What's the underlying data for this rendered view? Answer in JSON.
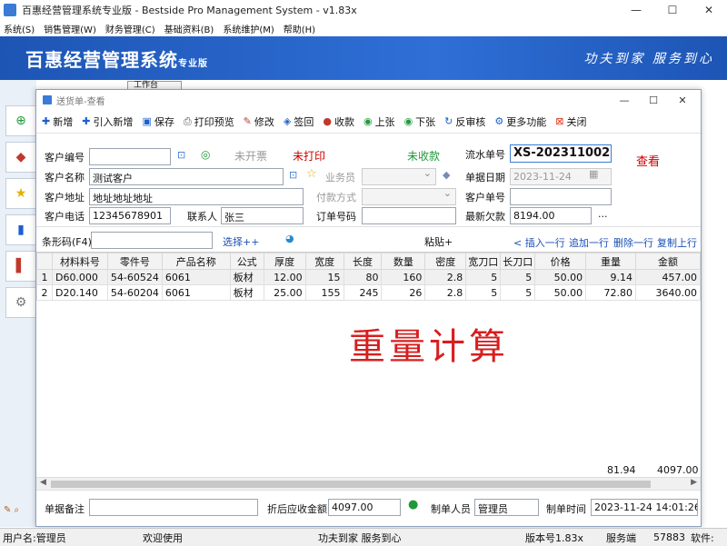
{
  "window": {
    "title": "百惠经营管理系统专业版 - Bestside Pro Management System - v1.83x",
    "minimize": "—",
    "maximize": "☐",
    "close": "✕"
  },
  "menu": [
    "系统(S)",
    "销售管理(W)",
    "财务管理(C)",
    "基础资料(B)",
    "系统维护(M)",
    "帮助(H)"
  ],
  "banner": {
    "brand": "百惠经营管理系统",
    "edition": "专业版",
    "slogan": "功夫到家 服务到心"
  },
  "sidebar": {
    "tab_label": "工作台"
  },
  "child_window": {
    "title": "送货单-查看",
    "minimize": "—",
    "maximize": "☐",
    "close": "✕"
  },
  "toolbar": {
    "items": [
      {
        "label": "新增",
        "icon": "plus-icon",
        "color": "#1a5fcf"
      },
      {
        "label": "引入新增",
        "icon": "plus-icon",
        "color": "#1a5fcf"
      },
      {
        "label": "保存",
        "icon": "save-icon",
        "color": "#1a5fcf"
      },
      {
        "label": "打印预览",
        "icon": "printer-icon",
        "color": "#555555"
      },
      {
        "label": "修改",
        "icon": "edit-icon",
        "color": "#c0392b"
      },
      {
        "label": "签回",
        "icon": "sign-icon",
        "color": "#2a62c9"
      },
      {
        "label": "收款",
        "icon": "money-icon",
        "color": "#c0392b"
      },
      {
        "label": "上张",
        "icon": "up-icon",
        "color": "#1f9a3a"
      },
      {
        "label": "下张",
        "icon": "down-icon",
        "color": "#1f9a3a"
      },
      {
        "label": "反审核",
        "icon": "reverse-icon",
        "color": "#1a5fcf"
      },
      {
        "label": "更多功能",
        "icon": "gear-icon",
        "color": "#1a5fcf"
      },
      {
        "label": "关闭",
        "icon": "close-icon",
        "color": "#d9381e"
      }
    ]
  },
  "form": {
    "customer_no_label": "客户编号",
    "customer_no": "",
    "invoice_status": "未开票",
    "print_status": "未打印",
    "payment_status": "未收款",
    "serial_label": "流水单号",
    "serial_no": "XS-202311002",
    "mode_tag": "查看",
    "customer_name_label": "客户名称",
    "customer_name": "测试客户",
    "salesman_label": "业务员",
    "salesman": "",
    "doc_date_label": "单据日期",
    "doc_date": "2023-11-24",
    "customer_addr_label": "客户地址",
    "customer_addr": "地址地址地址",
    "pay_method_label": "付款方式",
    "pay_method": "",
    "customer_order_label": "客户单号",
    "customer_order": "",
    "customer_phone_label": "客户电话",
    "customer_phone": "12345678901",
    "contact_label": "联系人",
    "contact": "张三",
    "order_no_label": "订单号码",
    "order_no": "",
    "latest_debt_label": "最新欠款",
    "latest_debt": "8194.00",
    "more": "...",
    "barcode_label": "条形码(F4)",
    "barcode": "",
    "select_link": "选择++",
    "paste_label": "粘贴+",
    "insert_row": "插入一行",
    "append_row": "追加一行",
    "delete_row": "删除一行",
    "copy_prev": "复制上行"
  },
  "table": {
    "columns": [
      "",
      "材料料号",
      "零件号",
      "产品名称",
      "公式",
      "厚度",
      "宽度",
      "长度",
      "数量",
      "密度",
      "宽刀口",
      "长刀口",
      "价格",
      "重量",
      "金额"
    ],
    "rows": [
      [
        "1",
        "D60.000",
        "54-60524",
        "6061",
        "板材",
        "12.00",
        "15",
        "80",
        "160",
        "2.8",
        "5",
        "5",
        "50.00",
        "9.14",
        "457.00"
      ],
      [
        "2",
        "D20.140",
        "54-60204",
        "6061",
        "板材",
        "25.00",
        "155",
        "245",
        "26",
        "2.8",
        "5",
        "5",
        "50.00",
        "72.80",
        "3640.00"
      ]
    ],
    "total_weight": "81.94",
    "total_amount": "4097.00"
  },
  "overlay_text": "重量计算",
  "footer": {
    "remark_label": "单据备注",
    "remark": "",
    "receivable_label": "折后应收金额",
    "receivable": "4097.00",
    "maker_label": "制单人员",
    "maker": "管理员",
    "made_time_label": "制单时间",
    "made_time": "2023-11-24 14:01:26"
  },
  "statusbar": {
    "user": "用户名:管理员",
    "welcome": "欢迎使用",
    "slogan": "功夫到家 服务到心",
    "version": "版本号1.83x",
    "service_label": "服务端",
    "port": "57883",
    "software": "软件:"
  }
}
